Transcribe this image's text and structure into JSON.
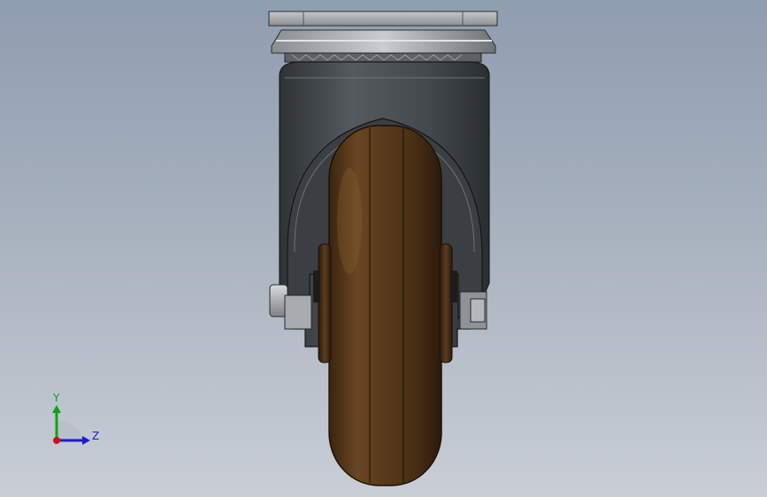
{
  "viewport": {
    "background_top": "#8f9db0",
    "background_bottom": "#c9ced6"
  },
  "model": {
    "name": "caster-wheel",
    "plate_color": "#9a9fa5",
    "fork_color": "#3f4448",
    "wheel_color": "#5a3a1e"
  },
  "triad": {
    "y_label": "Y",
    "z_label": "Z",
    "y_color": "#12a012",
    "z_color": "#1a1ad0",
    "x_color": "#d01010"
  }
}
